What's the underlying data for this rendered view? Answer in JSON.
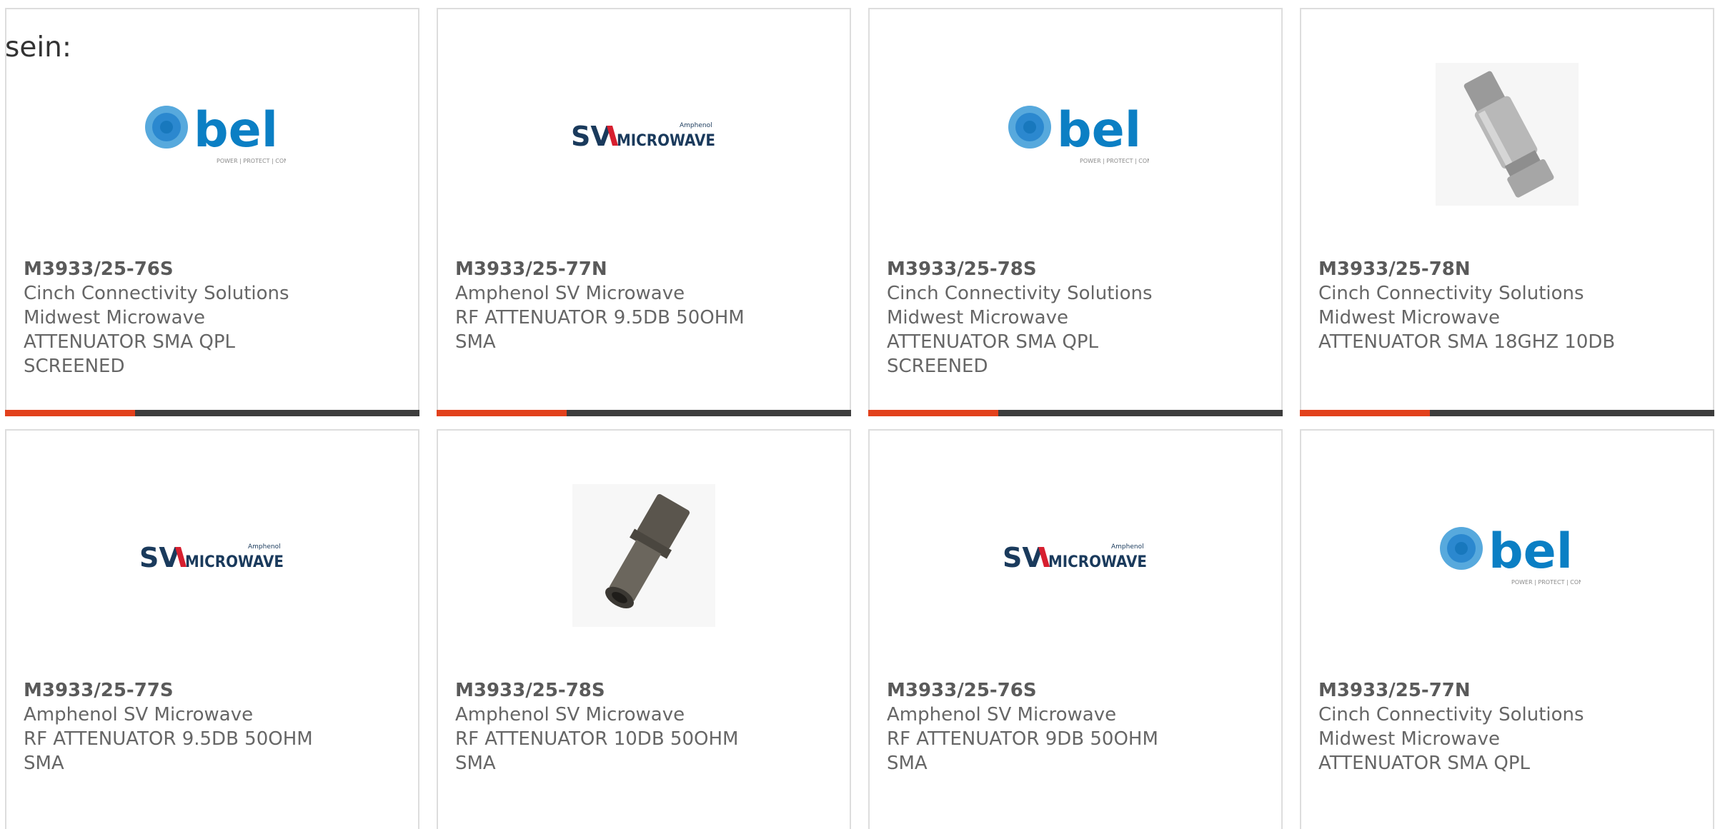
{
  "lead_text": "sein:",
  "colors": {
    "accent": "#e2411c",
    "bar": "#3d3d3d",
    "bel_blue": "#0b7fc4",
    "sv_navy": "#1a3a5c",
    "sv_red": "#d71f2f"
  },
  "cards": [
    {
      "part": "M3933/25-76S",
      "lines": [
        "Cinch Connectivity Solutions",
        "Midwest Microwave",
        "ATTENUATOR SMA QPL",
        "SCREENED"
      ],
      "image": "bel-logo",
      "tagline": "POWER | PROTECT | CONNECT"
    },
    {
      "part": "M3933/25-77N",
      "lines": [
        "Amphenol SV Microwave",
        "RF ATTENUATOR 9.5DB 50OHM",
        "SMA"
      ],
      "image": "sv-microwave-logo"
    },
    {
      "part": "M3933/25-78S",
      "lines": [
        "Cinch Connectivity Solutions",
        "Midwest Microwave",
        "ATTENUATOR SMA QPL",
        "SCREENED"
      ],
      "image": "bel-logo",
      "tagline": "POWER | PROTECT | CONNECT"
    },
    {
      "part": "M3933/25-78N",
      "lines": [
        "Cinch Connectivity Solutions",
        "Midwest Microwave",
        "ATTENUATOR SMA 18GHZ 10DB"
      ],
      "image": "attenuator-photo-silver"
    },
    {
      "part": "M3933/25-77S",
      "lines": [
        "Amphenol SV Microwave",
        "RF ATTENUATOR 9.5DB 50OHM",
        "SMA"
      ],
      "image": "sv-microwave-logo"
    },
    {
      "part": "M3933/25-78S",
      "lines": [
        "Amphenol SV Microwave",
        "RF ATTENUATOR 10DB 50OHM",
        "SMA"
      ],
      "image": "attenuator-photo-dark"
    },
    {
      "part": "M3933/25-76S",
      "lines": [
        "Amphenol SV Microwave",
        "RF ATTENUATOR 9DB 50OHM",
        "SMA"
      ],
      "image": "sv-microwave-logo"
    },
    {
      "part": "M3933/25-77N",
      "lines": [
        "Cinch Connectivity Solutions",
        "Midwest Microwave",
        "ATTENUATOR SMA QPL"
      ],
      "image": "bel-logo",
      "tagline": "POWER | PROTECT | CONNECT"
    }
  ],
  "logos": {
    "bel_word": "bel",
    "sv_letters": "SV",
    "sv_word": "MICROWAVE",
    "sv_brand": "Amphenol"
  }
}
